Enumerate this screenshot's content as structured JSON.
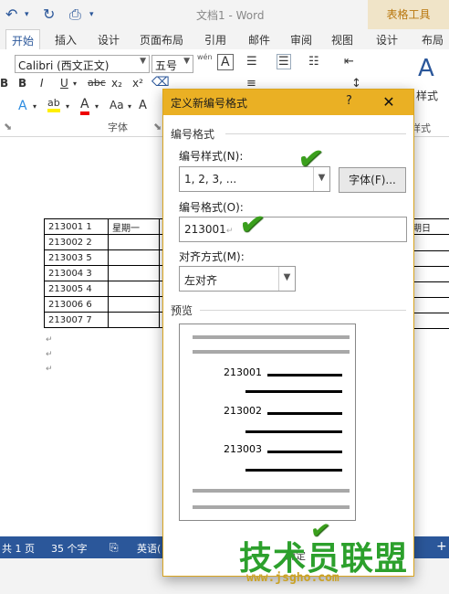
{
  "window": {
    "doc_title": "文档1 - Word",
    "context_tab": "表格工具"
  },
  "tabs": [
    "开始",
    "插入",
    "设计",
    "页面布局",
    "引用",
    "邮件",
    "审阅",
    "视图",
    "设计",
    "布局"
  ],
  "ribbon": {
    "font_name": "Calibri (西文正文)",
    "font_size": "五号",
    "group_font": "字体",
    "group_style": "样式",
    "group_style_short": "样式",
    "wen_label": "wén",
    "aa_label": "Aa"
  },
  "table": {
    "rows": [
      {
        "id": "213001",
        "num": "1",
        "day": "星期一"
      },
      {
        "id": "213002",
        "num": "2",
        "day": ""
      },
      {
        "id": "213003",
        "num": "5",
        "day": ""
      },
      {
        "id": "213004",
        "num": "3",
        "day": ""
      },
      {
        "id": "213005",
        "num": "4",
        "day": ""
      },
      {
        "id": "213006",
        "num": "6",
        "day": ""
      },
      {
        "id": "213007",
        "num": "7",
        "day": ""
      }
    ],
    "right_header": "期日"
  },
  "status": {
    "pages": "共 1 页",
    "words": "35 个字",
    "lang": "英语("
  },
  "dialog": {
    "title": "定义新编号格式",
    "help": "?",
    "close": "✕",
    "section_format": "编号格式",
    "style_label": "编号样式(N):",
    "style_value": "1, 2, 3, ...",
    "font_button": "字体(F)...",
    "format_label": "编号格式(O):",
    "format_value": "213001",
    "align_label": "对齐方式(M):",
    "align_value": "左对齐",
    "section_preview": "预览",
    "preview_numbers": [
      "213001",
      "213002",
      "213003"
    ],
    "ok_partial": "确定"
  },
  "watermark": {
    "brand": "技术员联盟",
    "url": "www.jsgho.com"
  }
}
